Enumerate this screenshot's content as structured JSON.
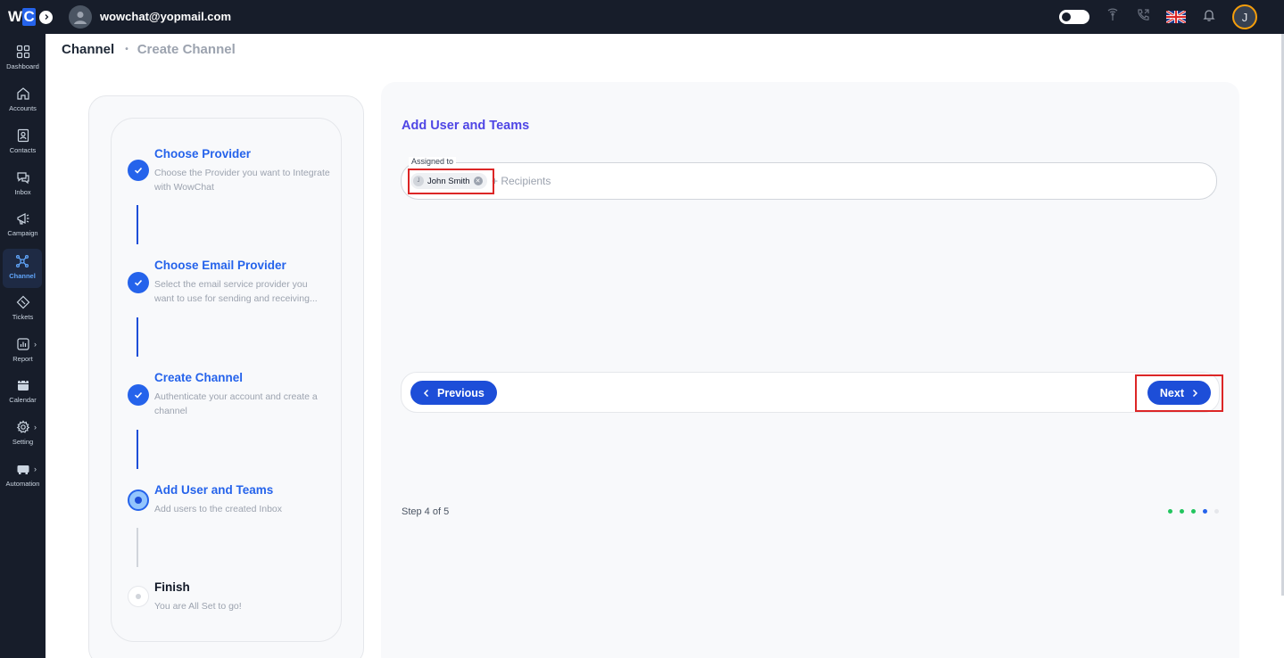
{
  "topbar": {
    "logo_text": "wc",
    "email": "wowchat@yopmail.com",
    "user_initial": "J"
  },
  "sidebar": {
    "items": [
      {
        "label": "Dashboard",
        "icon": "dashboard-icon"
      },
      {
        "label": "Accounts",
        "icon": "home-icon"
      },
      {
        "label": "Contacts",
        "icon": "contacts-icon"
      },
      {
        "label": "Inbox",
        "icon": "inbox-icon"
      },
      {
        "label": "Campaign",
        "icon": "megaphone-icon"
      },
      {
        "label": "Channel",
        "icon": "channel-icon",
        "active": true
      },
      {
        "label": "Tickets",
        "icon": "ticket-icon"
      },
      {
        "label": "Report",
        "icon": "report-icon",
        "has_submenu": true
      },
      {
        "label": "Calendar",
        "icon": "calendar-icon"
      },
      {
        "label": "Setting",
        "icon": "gear-icon",
        "has_submenu": true
      },
      {
        "label": "Automation",
        "icon": "automation-icon",
        "has_submenu": true
      }
    ]
  },
  "breadcrumb": {
    "current": "Channel",
    "separator": "•",
    "sub": "Create Channel"
  },
  "steps": [
    {
      "title": "Choose Provider",
      "desc": "Choose the Provider you want to Integrate with WowChat",
      "status": "done"
    },
    {
      "title": "Choose Email Provider",
      "desc": "Select the email service provider you want to use for sending and receiving...",
      "status": "done"
    },
    {
      "title": "Create Channel",
      "desc": "Authenticate your account and create a channel",
      "status": "done"
    },
    {
      "title": "Add User and Teams",
      "desc": "Add users to the created Inbox",
      "status": "current"
    },
    {
      "title": "Finish",
      "desc": "You are All Set to go!",
      "status": "pending"
    }
  ],
  "form": {
    "title": "Add User and Teams",
    "assigned_label": "Assigned to",
    "chip_initial": "J",
    "chip_name": "John Smith",
    "recipients_placeholder": "+ Recipients"
  },
  "buttons": {
    "previous": "Previous",
    "next": "Next"
  },
  "progress": {
    "text": "Step 4 of 5",
    "current_step": 4,
    "total_steps": 5,
    "done_color": "#22c55e",
    "current_color": "#2563eb",
    "pending_color": "#e5e7eb"
  },
  "colors": {
    "topbar_bg": "#171d2a",
    "accent": "#2563eb",
    "button": "#1d4ed8",
    "highlight": "#dc2626"
  }
}
